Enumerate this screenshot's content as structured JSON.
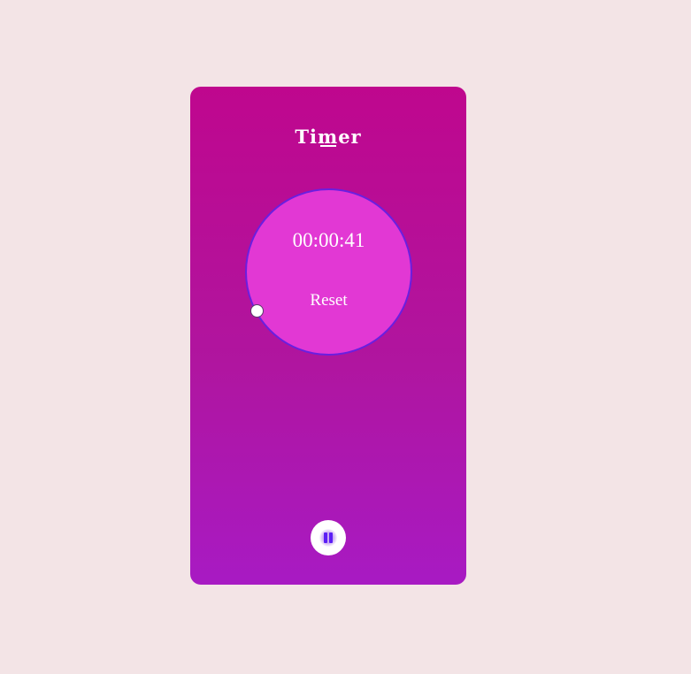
{
  "timer": {
    "title": "Timer",
    "time_display": "00:00:41",
    "reset_label": "Reset"
  },
  "controls": {
    "play_pause_icon": "pause-icon",
    "accent_color": "#5b1ff5"
  },
  "colors": {
    "page_background": "#f3e4e6",
    "card_gradient_top": "#bf078e",
    "card_gradient_bottom": "#a81ac3",
    "dial_fill": "#e238d4",
    "dial_border": "#6a1fe0"
  }
}
